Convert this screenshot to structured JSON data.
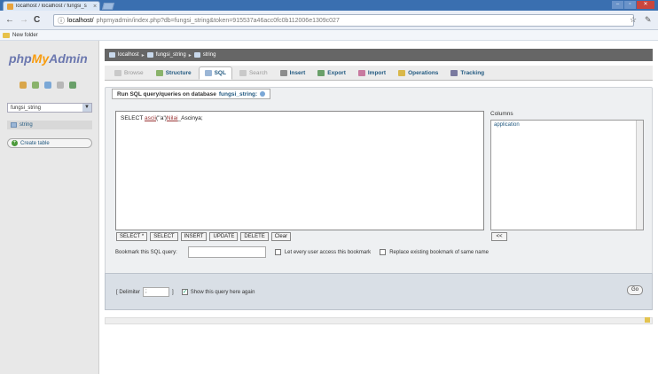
{
  "browser": {
    "tab_title": "localhost / localhost / fungsi_s",
    "tab_close": "×",
    "window_buttons": [
      "–",
      "▫",
      "✕"
    ],
    "nav": {
      "back": "←",
      "forward": "→",
      "reload": "C"
    },
    "address_host": "localhost/",
    "address_rest": "phpmyadmin/index.php?db=fungsi_string&token=915537a46acc0fc0b112006e1309c027",
    "bookmark_folder": "New folder"
  },
  "sidebar": {
    "logo_php": "php",
    "logo_my": "My",
    "logo_admin": "Admin",
    "db_selected": "fungsi_string",
    "db_arrow": "▼",
    "table_item": "string",
    "create_table": "Create table",
    "create_table_glyph": "+"
  },
  "breadcrumb": {
    "server": "localhost",
    "sep": "▸",
    "database": "fungsi_string",
    "table": "string"
  },
  "tabs": [
    {
      "label": "Browse",
      "state": "disabled",
      "icon": "browse-icon",
      "color": "#c9c9c9"
    },
    {
      "label": "Structure",
      "state": "normal",
      "icon": "structure-icon",
      "color": "#8ab36b"
    },
    {
      "label": "SQL",
      "state": "active",
      "icon": "sql-icon",
      "color": "#9bb6d6"
    },
    {
      "label": "Search",
      "state": "disabled",
      "icon": "search-icon",
      "color": "#c9c9c9"
    },
    {
      "label": "Insert",
      "state": "normal",
      "icon": "insert-icon",
      "color": "#8c8c8c"
    },
    {
      "label": "Export",
      "state": "normal",
      "icon": "export-icon",
      "color": "#6aa06a"
    },
    {
      "label": "Import",
      "state": "normal",
      "icon": "import-icon",
      "color": "#c87aa0"
    },
    {
      "label": "Operations",
      "state": "normal",
      "icon": "operations-icon",
      "color": "#d9b84a"
    },
    {
      "label": "Tracking",
      "state": "normal",
      "icon": "tracking-icon",
      "color": "#7a7aa0"
    }
  ],
  "sql_panel": {
    "legend_prefix": "Run SQL query/queries on database",
    "legend_db": "fungsi_string:",
    "query_part1": "SELECT ",
    "query_kw1": "ascii",
    "query_part2": "('ʻa')",
    "query_kw2": "Nilai",
    "query_part3": "_Ascinya;",
    "columns_label": "Columns",
    "columns": [
      "application"
    ],
    "buttons": [
      "SELECT *",
      "SELECT",
      "INSERT",
      "UPDATE",
      "DELETE",
      "Clear"
    ],
    "insert_arrow": "<<",
    "bookmark_label": "Bookmark this SQL query:",
    "let_every_user": "Let every user access this bookmark",
    "replace_existing": "Replace existing bookmark of same name",
    "delimiter_label": "[ Delimiter",
    "delimiter_value": ";",
    "delimiter_close": "]",
    "show_query_again": "Show this query here again",
    "go": "Go"
  }
}
